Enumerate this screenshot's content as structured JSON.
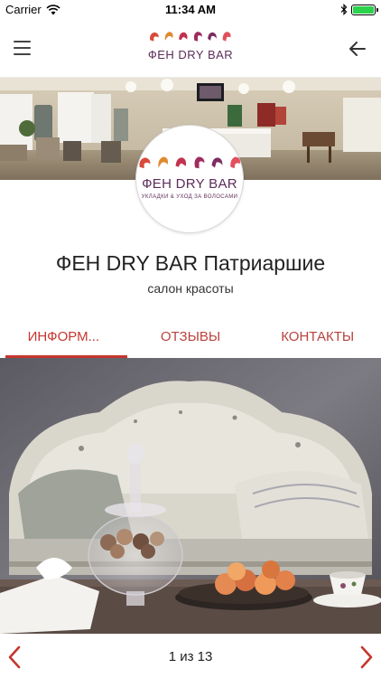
{
  "status_bar": {
    "carrier": "Carrier",
    "time": "11:34 AM"
  },
  "header": {
    "logo_text": "ФEH DRY BAR",
    "menu_icon": "hamburger-icon",
    "back_icon": "arrow-left-icon"
  },
  "profile": {
    "logo_text": "ФEH DRY BAR",
    "tagline": "УКЛАДКИ & УХОД ЗА ВОЛОСАМИ",
    "name": "ФЕН DRY BAR Патриаршие",
    "category": "салон красоты"
  },
  "tabs": [
    {
      "label": "ИНФОРМ...",
      "active": true
    },
    {
      "label": "ОТЗЫВЫ",
      "active": false
    },
    {
      "label": "КОНТАКТЫ",
      "active": false
    }
  ],
  "gallery": {
    "counter": "1 из 13",
    "current": 1,
    "total": 13
  },
  "colors": {
    "accent": "#c6362f",
    "brand_purple": "#5d2d5a",
    "logo_palette": [
      "#d94a3a",
      "#e0892f",
      "#c2324d",
      "#a02b5e",
      "#7b2d61",
      "#e2505b"
    ]
  }
}
